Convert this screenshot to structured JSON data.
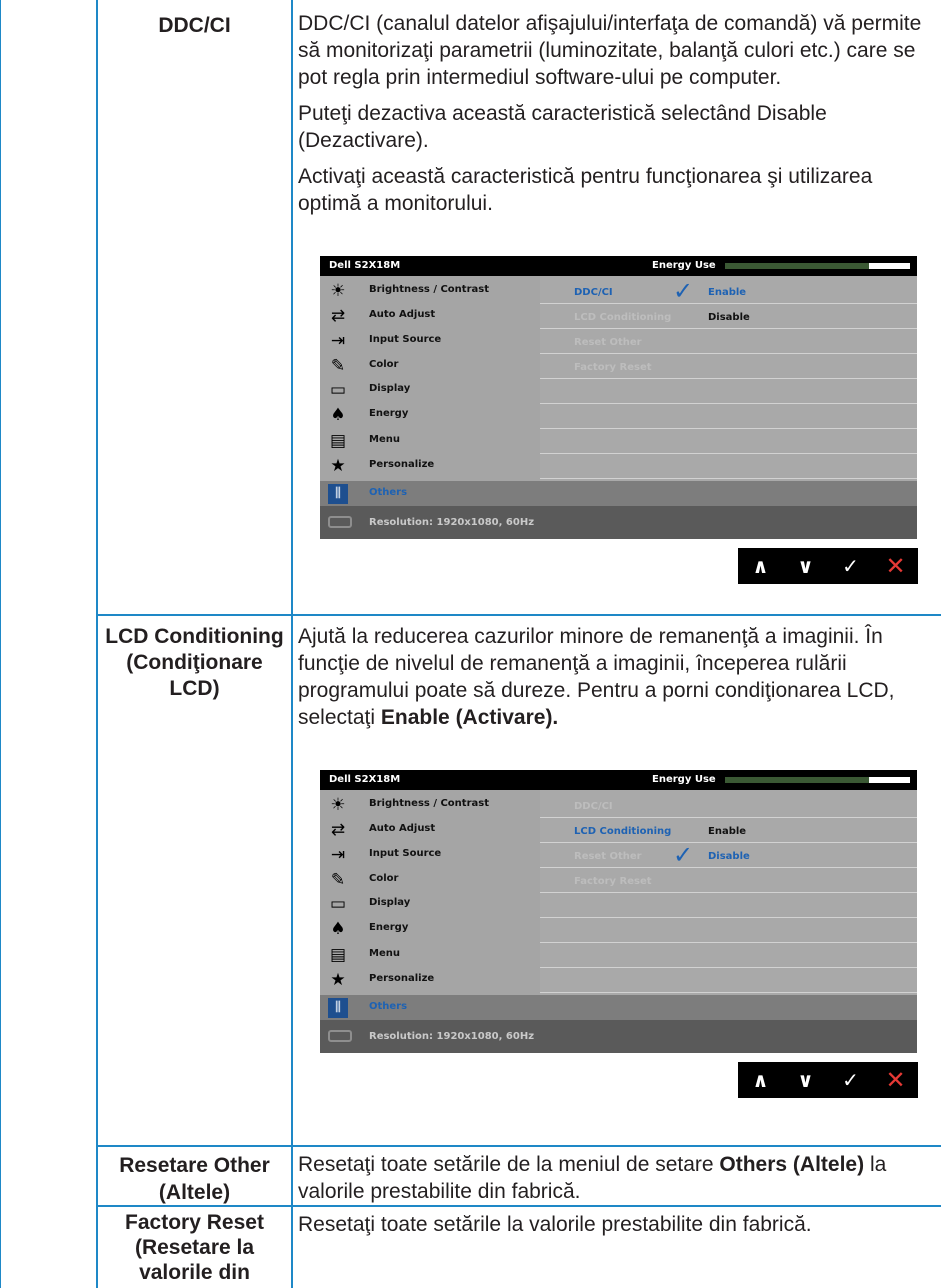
{
  "rows": [
    {
      "label": "DDC/CI",
      "paragraphs": [
        "DDC/CI (canalul datelor afişajului/interfaţa de comandă) vă permite să monitorizaţi parametrii (luminozitate, balanţă culori etc.) care se pot regla prin intermediul software-ului pe computer.",
        "Puteţi dezactiva această caracteristică selectând Disable (Dezactivare).",
        "Activaţi această caracteristică pentru funcţionarea şi utilizarea optimă a monitorului."
      ]
    },
    {
      "label": "LCD Conditioning (Condiţionare LCD)",
      "text_before": "Ajută la reducerea cazurilor minore de remanenţă a imaginii. În funcţie de nivelul de remanenţă a imaginii, începerea rulării programului poate să dureze. Pentru a porni condiţionarea LCD, selectaţi ",
      "text_bold": "Enable (Activare)."
    },
    {
      "label": "Resetare Other (Altele)",
      "text_before": "Resetaţi toate setările de la meniul de setare ",
      "text_bold": "Others (Altele)",
      "text_after": " la valorile prestabilite din fabrică."
    },
    {
      "label": "Factory Reset (Resetare la valorile din fabrică)",
      "text": "Resetaţi toate setările la valorile prestabilite din fabrică."
    }
  ],
  "osd": {
    "model": "Dell S2X18M",
    "energy_label": "Energy Use",
    "energy_level": 0.78,
    "menu": [
      {
        "label": "Brightness / Contrast",
        "icon": "sun-icon"
      },
      {
        "label": "Auto Adjust",
        "icon": "auto-adjust-icon"
      },
      {
        "label": "Input Source",
        "icon": "input-source-icon"
      },
      {
        "label": "Color",
        "icon": "color-icon"
      },
      {
        "label": "Display",
        "icon": "display-icon"
      },
      {
        "label": "Energy",
        "icon": "energy-icon"
      },
      {
        "label": "Menu",
        "icon": "menu-icon"
      },
      {
        "label": "Personalize",
        "icon": "star-icon"
      },
      {
        "label": "Others",
        "icon": "others-icon"
      }
    ],
    "submenu": [
      "DDC/CI",
      "LCD Conditioning",
      "Reset Other",
      "Factory Reset"
    ],
    "option_enable": "Enable",
    "option_disable": "Disable",
    "resolution": "Resolution: 1920x1080, 60Hz",
    "ddc_selected": "Enable",
    "lcd_selected": "Disable"
  },
  "nav_buttons": [
    "up",
    "down",
    "ok",
    "exit"
  ]
}
